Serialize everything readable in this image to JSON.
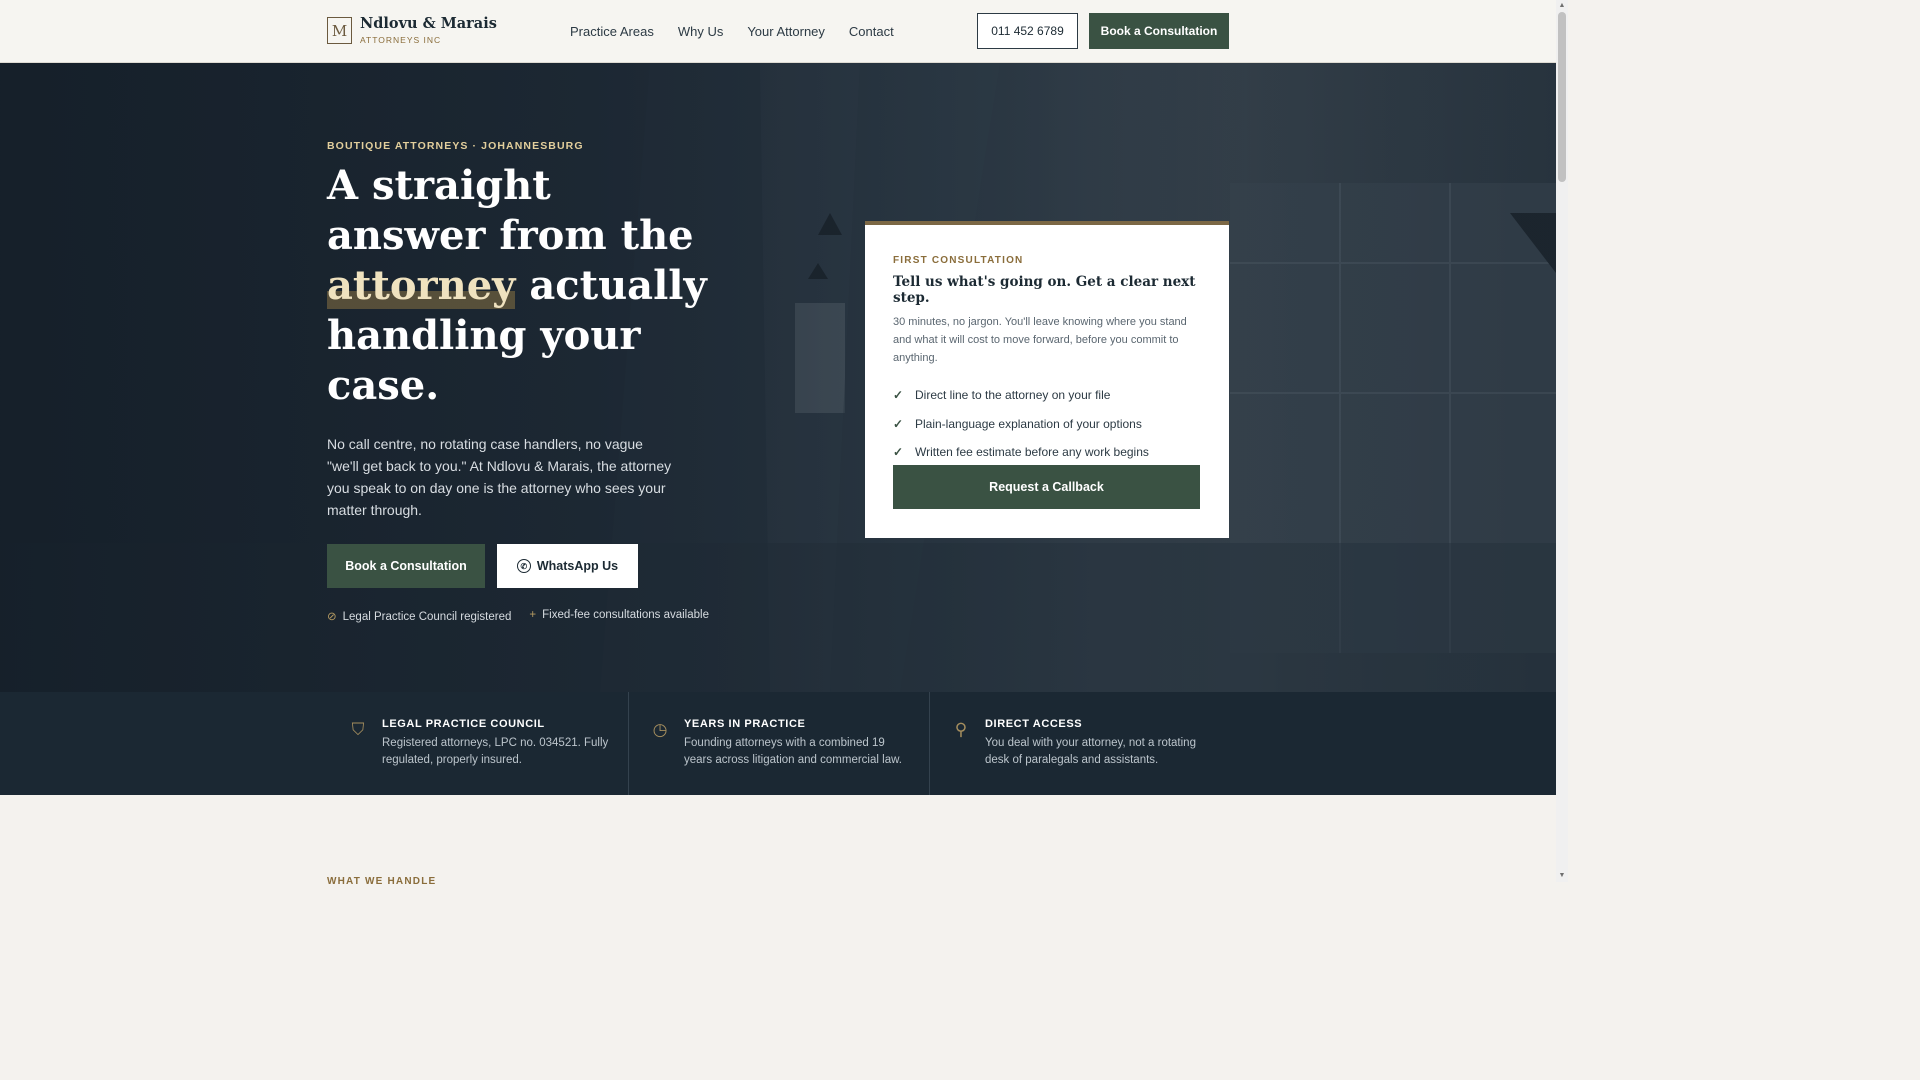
{
  "header": {
    "logo_name": "Ndlovu & Marais",
    "logo_sub": "ATTORNEYS INC",
    "nav": [
      "Practice Areas",
      "Why Us",
      "Your Attorney",
      "Contact"
    ],
    "phone": "011 452 6789",
    "book_label": "Book a Consultation"
  },
  "hero": {
    "eyebrow": "BOUTIQUE ATTORNEYS · JOHANNESBURG",
    "headline_pre": "A straight answer from the",
    "headline_highlight": "attorney",
    "headline_post": "actually handling your case.",
    "description": "No call centre, no rotating case handlers, no vague \"we'll get back to you.\" At Ndlovu & Marais, the attorney you speak to on day one is the attorney who sees your matter through.",
    "book_label": "Book a Consultation",
    "whatsapp_label": "WhatsApp Us",
    "trust": [
      "Legal Practice Council registered",
      "Fixed-fee consultations available"
    ]
  },
  "card": {
    "eyebrow": "FIRST CONSULTATION",
    "title": "Tell us what's going on. Get a clear next step.",
    "text": "30 minutes, no jargon. You'll leave knowing where you stand and what it will cost to move forward, before you commit to anything.",
    "items": [
      "Direct line to the attorney on your file",
      "Plain-language explanation of your options",
      "Written fee estimate before any work begins"
    ],
    "cta": "Request a Callback"
  },
  "bar": [
    {
      "title": "LEGAL PRACTICE COUNCIL",
      "text": "Registered attorneys, LPC no. 034521. Fully regulated, properly insured.",
      "icon": "shield-icon"
    },
    {
      "title": "YEARS IN PRACTICE",
      "text": "Founding attorneys with a combined 19 years across litigation and commercial law.",
      "icon": "clock-icon"
    },
    {
      "title": "DIRECT ACCESS",
      "text": "You deal with your attorney, not a rotating desk of paralegals and assistants.",
      "icon": "person-icon"
    }
  ],
  "next_section": {
    "eyebrow": "WHAT WE HANDLE"
  },
  "colors": {
    "accent": "#3a5243",
    "gold": "#8a6d3b",
    "dark": "#1b2833"
  }
}
